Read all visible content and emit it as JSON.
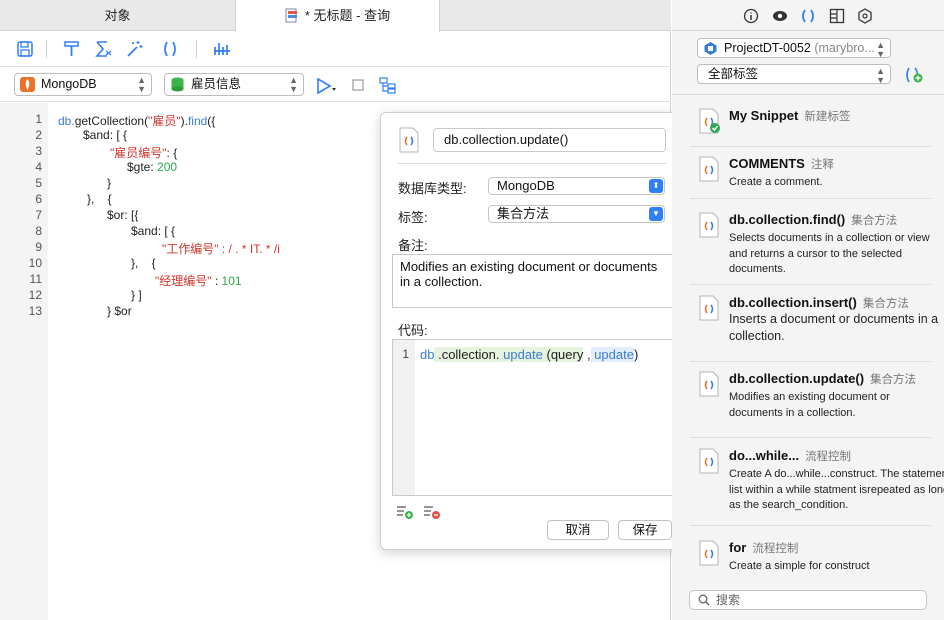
{
  "tabs": {
    "objects": "对象",
    "query": "* 无标题 - 查询"
  },
  "toolbar2": {
    "db_type": "MongoDB",
    "collection": "雇员信息"
  },
  "editor": {
    "line_numbers": [
      "1",
      "2",
      "3",
      "4",
      "5",
      "6",
      "7",
      "8",
      "9",
      "10",
      "11",
      "12",
      "13"
    ],
    "lines": [
      [
        [
          "db.",
          "c-blue"
        ],
        [
          "getCollection(",
          ""
        ],
        [
          "\"雇员\"",
          "c-red"
        ],
        [
          ").",
          ""
        ],
        [
          "find",
          "c-blue"
        ],
        [
          "({",
          ""
        ]
      ],
      [
        [
          "$and: [ {",
          ""
        ]
      ],
      [
        [
          "\"雇员编号\"",
          "c-red"
        ],
        [
          ": {",
          ""
        ]
      ],
      [
        [
          "$gte: ",
          ""
        ],
        [
          "200",
          "c-green"
        ]
      ],
      [
        [
          "}",
          ""
        ]
      ],
      [
        [
          "},    {",
          ""
        ]
      ],
      [
        [
          "$or: [{",
          ""
        ]
      ],
      [
        [
          "$and: [ {",
          ""
        ]
      ],
      [
        [
          "\"工作编号\" : / . * IT. * /i",
          "c-red"
        ]
      ],
      [
        [
          "},    {",
          ""
        ]
      ],
      [
        [
          "\"经理编号\"",
          "c-red"
        ],
        [
          " : ",
          ""
        ],
        [
          "101",
          "c-green"
        ]
      ],
      [
        [
          "} ]",
          ""
        ]
      ],
      [
        [
          "} $or",
          ""
        ]
      ]
    ]
  },
  "popover": {
    "name": "db.collection.update()",
    "db_type_label": "数据库类型:",
    "db_type_value": "MongoDB",
    "tag_label": "标签:",
    "tag_value": "集合方法",
    "remark_label": "备注:",
    "remark_text": "Modifies an existing document or documents in a collection.",
    "code_label": "代码:",
    "code_line_number": "1",
    "code": {
      "db": "db",
      "collection": " .collection.",
      "update": " update",
      "query": " (query",
      "comma": " ,",
      "update2": " update",
      "close": ")"
    },
    "cancel": "取消",
    "save": "保存"
  },
  "right": {
    "project": "ProjectDT-0052",
    "project_owner": "(marybro...",
    "tag_filter": "全部标签",
    "snippets": [
      {
        "title": "My Snippet",
        "tag": "新建标签",
        "desc": ""
      },
      {
        "title": "COMMENTS",
        "tag": "注释",
        "desc": "Create a comment."
      },
      {
        "title": "db.collection.find()",
        "tag": "集合方法",
        "desc": "Selects documents in a collection or view and returns a cursor to the selected documents."
      },
      {
        "title": "db.collection.insert()",
        "tag": "集合方法",
        "desc": "Inserts  a document or documents in a collection."
      },
      {
        "title": "db.collection.update()",
        "tag": "集合方法",
        "desc": "Modifies an existing document or documents in  a collection."
      },
      {
        "title": "do...while...",
        "tag": "流程控制",
        "desc": "Create A do...while...construct. The statement list within a while statment isrepeated as long as the search_condition."
      },
      {
        "title": "for",
        "tag": "流程控制",
        "desc": "Create a simple for construct"
      }
    ],
    "search_placeholder": "搜索"
  },
  "colors": {
    "accent": "#2f7ff5",
    "code_blue": "#3a7bd5",
    "code_red": "#d0342c",
    "code_green": "#2fa84f"
  }
}
